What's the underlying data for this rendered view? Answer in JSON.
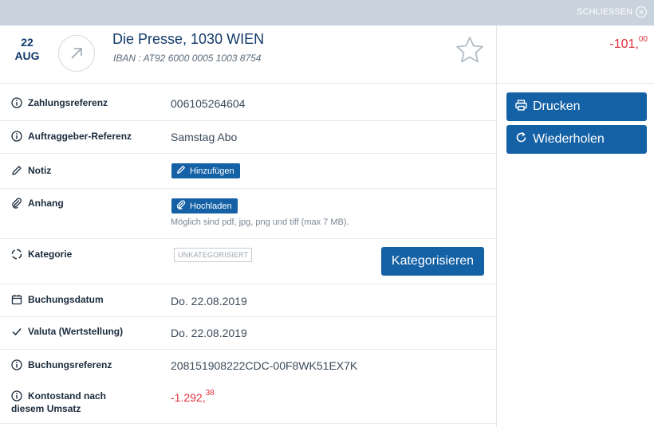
{
  "topbar": {
    "close_label": "SCHLIESSEN"
  },
  "transaction": {
    "day": "22",
    "month": "AUG",
    "title": "Die Presse, 1030 WIEN",
    "iban": "IBAN : AT92 6000 0005 1003 8754",
    "amount_main": "-101,",
    "amount_cents": "00"
  },
  "actions": {
    "print_label": "Drucken",
    "repeat_label": "Wiederholen"
  },
  "details": {
    "zahlungsreferenz": {
      "label": "Zahlungsreferenz",
      "value": "006105264604"
    },
    "auftraggeber": {
      "label": "Auftraggeber-Referenz",
      "value": "Samstag Abo"
    },
    "notiz": {
      "label": "Notiz",
      "button": "Hinzufügen"
    },
    "anhang": {
      "label": "Anhang",
      "button": "Hochladen",
      "hint": "Möglich sind pdf, jpg, png und tiff (max 7 MB)."
    },
    "kategorie": {
      "label": "Kategorie",
      "badge": "UNKATEGORISIERT",
      "button": "Kategorisieren"
    },
    "buchungsdatum": {
      "label": "Buchungsdatum",
      "value": "Do. 22.08.2019"
    },
    "valuta": {
      "label": "Valuta (Wertstellung)",
      "value": "Do. 22.08.2019"
    },
    "buchungsreferenz": {
      "label": "Buchungsreferenz",
      "value": "208151908222CDC-00F8WK51EX7K"
    },
    "kontostand": {
      "label_line1": "Kontostand nach",
      "label_line2": "diesem Umsatz",
      "value_main": "-1.292,",
      "value_cents": "38"
    }
  },
  "colors": {
    "accent": "#1461a5",
    "negative": "#e0313b",
    "topbar": "#c9d3dd",
    "title": "#123a6b"
  }
}
